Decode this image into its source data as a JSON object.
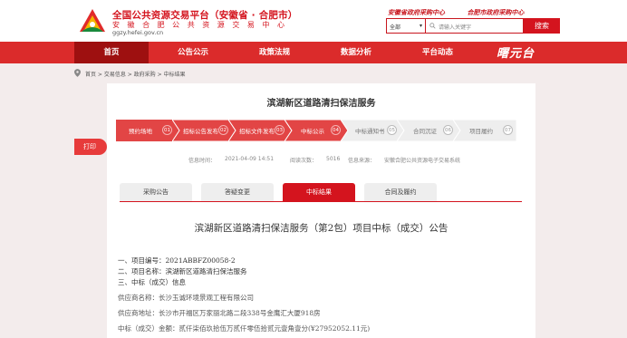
{
  "header": {
    "title": "全国公共资源交易平台（安徽省 · 合肥市）",
    "subtitle": "安 徽 合 肥 公 共 资 源 交 易 中 心",
    "url": "ggzy.hefei.gov.cn",
    "slogans": [
      "安徽省政府采购中心",
      "合肥市政府采购中心"
    ],
    "search": {
      "select_value": "全部",
      "placeholder": "请输入关键字",
      "button_label": "搜索"
    }
  },
  "nav": {
    "items": [
      {
        "label": "首页",
        "active": true
      },
      {
        "label": "公告公示",
        "active": false
      },
      {
        "label": "政策法规",
        "active": false
      },
      {
        "label": "数据分析",
        "active": false
      },
      {
        "label": "平台动态",
        "active": false
      }
    ],
    "brand": "曙元台"
  },
  "breadcrumb": {
    "text": "首页 > 交易信息 > 政府采购 > 中标结果"
  },
  "side": {
    "print_label": "打印"
  },
  "project": {
    "title": "滨湖新区道路清扫保洁服务",
    "steps": [
      {
        "label": "预约场地",
        "num": "01",
        "state": "done"
      },
      {
        "label": "招标公告发布",
        "num": "02",
        "state": "done"
      },
      {
        "label": "招标文件发布",
        "num": "03",
        "state": "done"
      },
      {
        "label": "中标公示",
        "num": "04",
        "state": "done"
      },
      {
        "label": "中标通知书",
        "num": "05",
        "state": "todo"
      },
      {
        "label": "合同沉证",
        "num": "06",
        "state": "todo"
      },
      {
        "label": "项目履约",
        "num": "07",
        "state": "todo"
      }
    ],
    "meta": {
      "time_label": "信息时间：",
      "time_value": "2021-04-09 14:51",
      "views_label": "阅读次数：",
      "views_value": "5016",
      "source_label": "信息来源：",
      "source_value": "安徽合肥公共资源电子交易系统"
    },
    "tabs": [
      {
        "label": "采购公告",
        "active": false
      },
      {
        "label": "答疑变更",
        "active": false
      },
      {
        "label": "中标结果",
        "active": true
      },
      {
        "label": "合同及履约",
        "active": false
      }
    ]
  },
  "document": {
    "title": "滨湖新区道路清扫保洁服务（第2包）项目中标（成交）公告",
    "lines": [
      "一、项目编号：2021ABBFZ00058-2",
      "二、项目名称：滨湖新区道路清扫保洁服务",
      "三、中标（成交）信息",
      "供应商名称：长沙玉诚环境景观工程有限公司",
      "供应商地址：长沙市开福区万家丽北路二段338号金鹰汇大厦918房",
      "中标（成交）金额：贰仟柒佰玖拾伍万贰仟零伍拾贰元壹角壹分(¥27952052.11元)"
    ]
  },
  "colors": {
    "brand_red": "#d4141e",
    "nav_red": "#db2b2b",
    "nav_active": "#9e1010",
    "step_done": "#e24545",
    "step_todo": "#eeeeee"
  }
}
